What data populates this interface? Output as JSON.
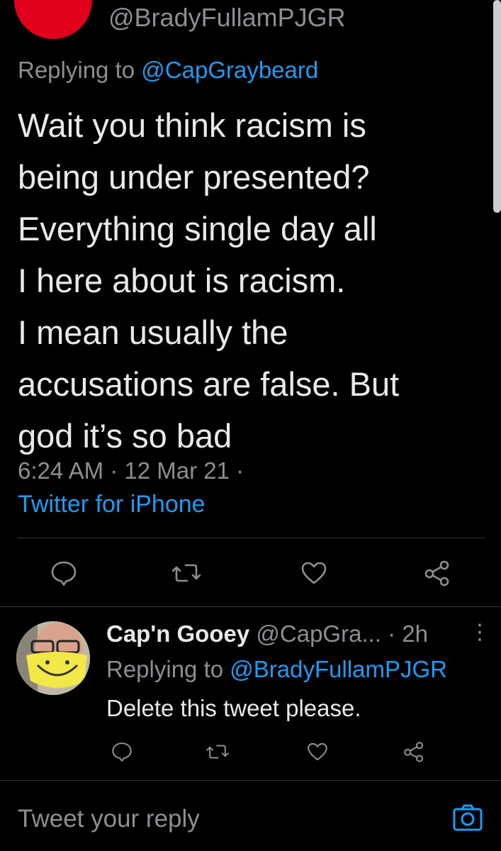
{
  "tweet": {
    "author_handle": "@BradyFullamPJGR",
    "replying_prefix": "Replying to",
    "replying_to": "@CapGraybeard",
    "text": "Wait you think racism is\nbeing under presented?\nEverything single day all\nI here about is racism.\nI mean usually the\naccusations are false. But\ngod it’s so bad",
    "time_date": "6:24 AM · 12 Mar 21 ·",
    "source": "Twitter for iPhone"
  },
  "reply": {
    "name": "Cap'n Gooey",
    "handle": "@CapGra...",
    "age": "· 2h",
    "more": "⋮",
    "replying_prefix": "Replying to",
    "replying_to": "@BradyFullamPJGR",
    "text": "Delete this tweet please."
  },
  "composer": {
    "placeholder": "Tweet your reply"
  },
  "icons": {
    "reply": "reply-icon",
    "retweet": "retweet-icon",
    "like": "like-icon",
    "share": "share-icon",
    "camera": "camera-icon"
  },
  "colors": {
    "background": "#000000",
    "accent": "#1d9bf0",
    "secondary_text": "#8b8f94",
    "primary_text": "#e7e9ea"
  }
}
